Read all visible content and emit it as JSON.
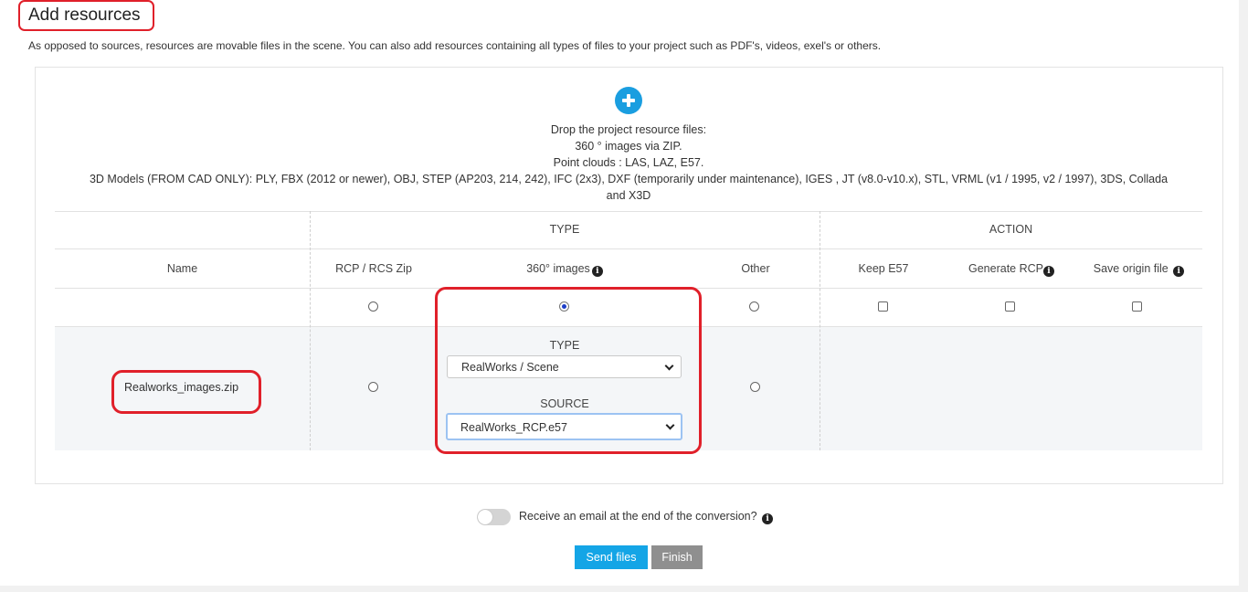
{
  "header": {
    "title": "Add resources",
    "description": "As opposed to sources, resources are movable files in the scene. You can also add resources containing all types of files to your project such as PDF's, videos, exel's or others."
  },
  "dropzone": {
    "icon": "plus-circle-icon",
    "line1": "Drop the project resource files:",
    "line2": "360 ° images via ZIP.",
    "line3": "Point clouds : LAS, LAZ, E57.",
    "line4": "3D Models (FROM CAD ONLY): PLY, FBX (2012 or newer), OBJ, STEP (AP203, 214, 242), IFC (2x3), DXF (temporarily under maintenance), IGES , JT (v8.0-v10.x), STL, VRML (v1 / 1995, v2 / 1997), 3DS, Collada",
    "line5": "and X3D"
  },
  "table": {
    "group_type": "TYPE",
    "group_action": "ACTION",
    "columns": {
      "name": "Name",
      "rcp": "RCP / RCS Zip",
      "images360": "360° images",
      "other": "Other",
      "keep_e57": "Keep E57",
      "generate_rcp": "Generate RCP",
      "save_origin": "Save origin file"
    },
    "global_row": {
      "selected_type": "360° images",
      "keep_e57": false,
      "generate_rcp": false,
      "save_origin": false
    },
    "files": [
      {
        "name": "Realworks_images.zip",
        "selected_type": "360° images",
        "type_label": "TYPE",
        "type_value": "RealWorks / Scene",
        "source_label": "SOURCE",
        "source_value": "RealWorks_RCP.e57"
      }
    ]
  },
  "footer": {
    "email_toggle_label": "Receive an email at the end of the conversion?",
    "email_toggle_on": false,
    "send_label": "Send files",
    "finish_label": "Finish"
  },
  "colors": {
    "accent": "#14a5e6",
    "finish_button": "#8f8f8f",
    "highlight": "#e0202a",
    "radio_selected": "#1d3ec8"
  }
}
